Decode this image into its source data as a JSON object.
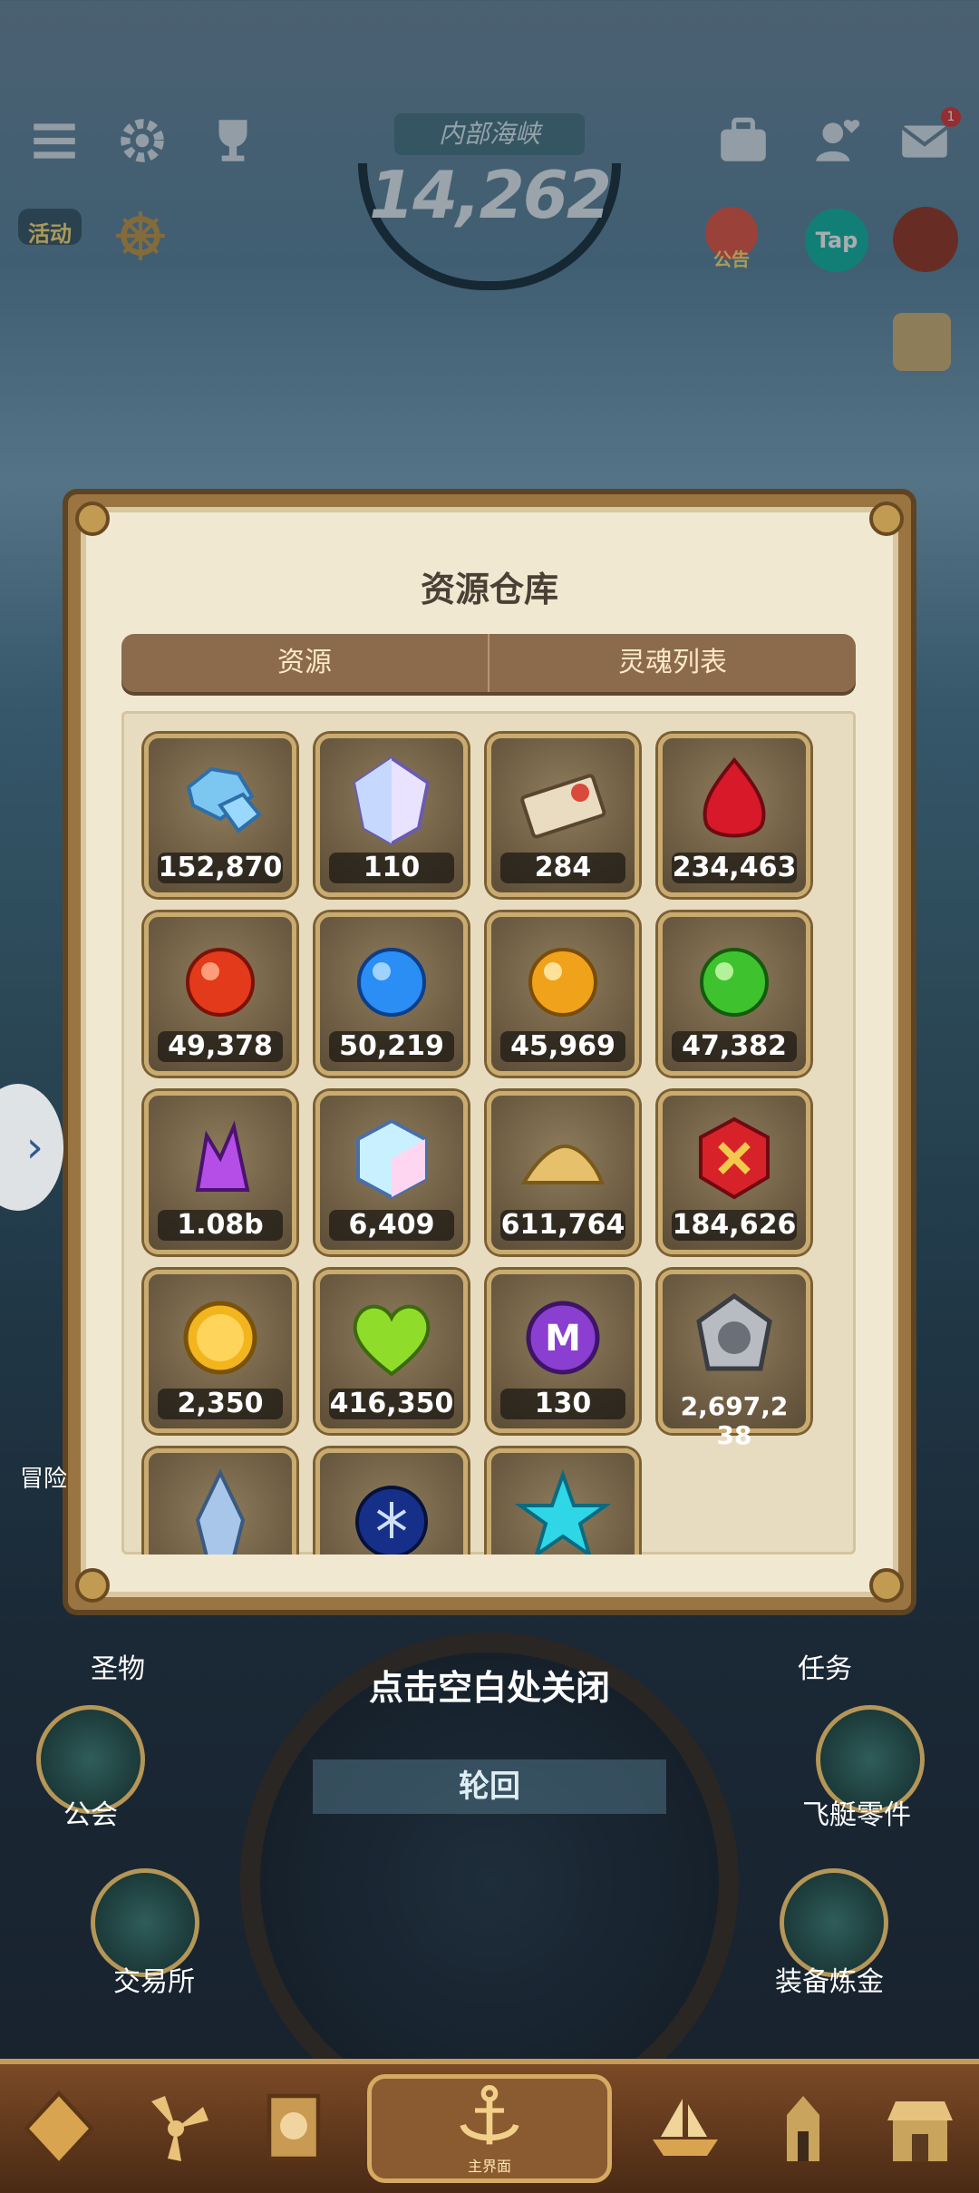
{
  "hud": {
    "region_name": "内部海峡",
    "power": "14,262",
    "activity_label": "活动",
    "notice_label": "公告",
    "tap_label": "Tap",
    "mail_badge": "1"
  },
  "modal": {
    "title": "资源仓库",
    "tabs": [
      "资源",
      "灵魂列表"
    ],
    "items": [
      {
        "icon": "blue-diamond-icon",
        "count": "152,870"
      },
      {
        "icon": "prism-crystal-icon",
        "count": "110"
      },
      {
        "icon": "ticket-letter-icon",
        "count": "284"
      },
      {
        "icon": "red-gem-icon",
        "count": "234,463"
      },
      {
        "icon": "fire-orb-icon",
        "count": "49,378"
      },
      {
        "icon": "water-orb-icon",
        "count": "50,219"
      },
      {
        "icon": "gold-orb-icon",
        "count": "45,969"
      },
      {
        "icon": "green-orb-icon",
        "count": "47,382"
      },
      {
        "icon": "purple-crystal-icon",
        "count": "1.08b"
      },
      {
        "icon": "rainbow-cube-icon",
        "count": "6,409"
      },
      {
        "icon": "gold-dust-icon",
        "count": "611,764"
      },
      {
        "icon": "red-cross-badge-icon",
        "count": "184,626"
      },
      {
        "icon": "gold-coin-icon",
        "count": "2,350"
      },
      {
        "icon": "green-heart-icon",
        "count": "416,350"
      },
      {
        "icon": "purple-m-coin-icon",
        "count": "130"
      },
      {
        "icon": "silver-medal-icon",
        "count": "2,697,238"
      },
      {
        "icon": "ice-shard-icon",
        "count": ""
      },
      {
        "icon": "blue-star-orb-icon",
        "count": ""
      },
      {
        "icon": "cyan-star-icon",
        "count": ""
      }
    ]
  },
  "close_hint": "点击空白处关闭",
  "menu": {
    "relic": "圣物",
    "task": "任务",
    "guild": "公会",
    "airship_parts": "飞艇零件",
    "exchange": "交易所",
    "equip_alchemy": "装备炼金",
    "reborn": "轮回",
    "adventure": "冒险"
  },
  "bottom_nav": {
    "home_label": "主界面"
  },
  "colors": {
    "modal_bg": "#f1e8d1",
    "modal_border": "#9b7541",
    "tab_bg": "#8b6b4b",
    "slot_border": "#c9ab6f"
  }
}
